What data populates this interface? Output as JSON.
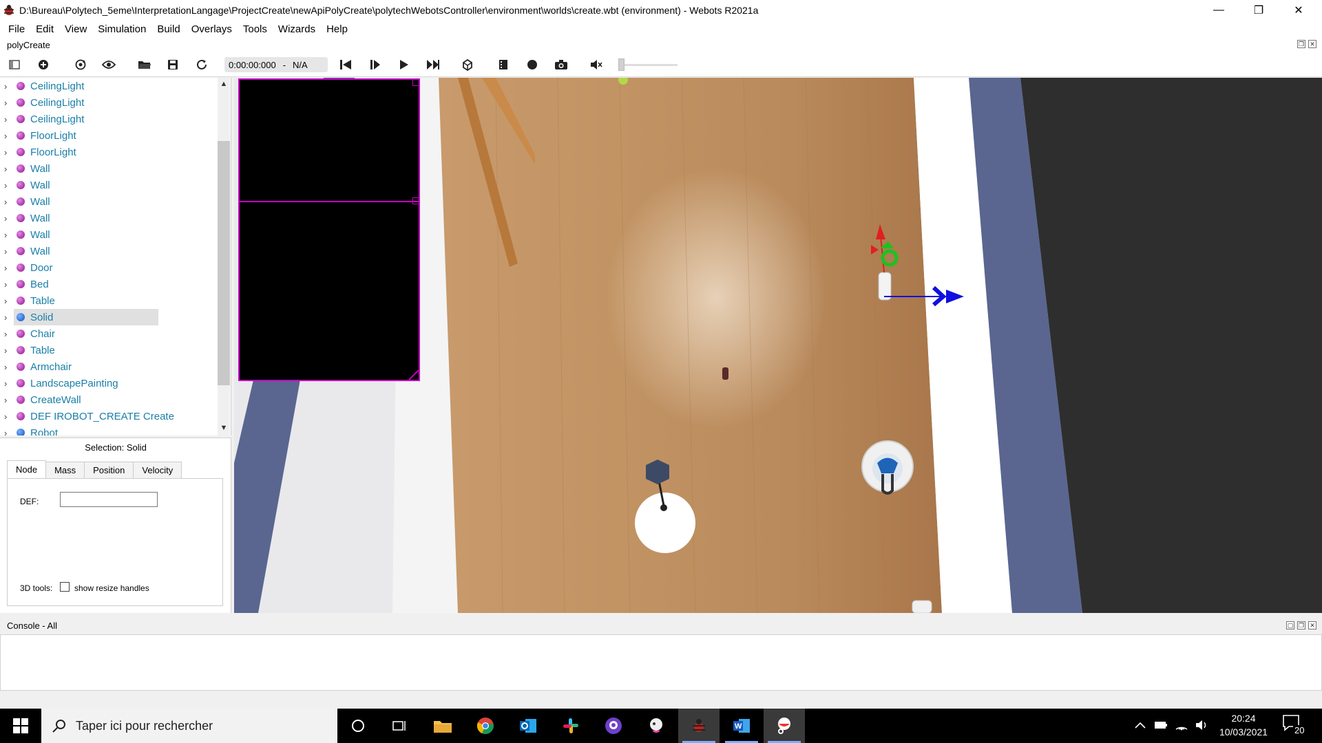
{
  "window": {
    "title": "D:\\Bureau\\Polytech_5eme\\InterpretationLangage\\ProjectCreate\\newApiPolyCreate\\polytechWebotsController\\environment\\worlds\\create.wbt (environment) - Webots R2021a",
    "minimize": "—",
    "restore": "❐",
    "close": "✕"
  },
  "menu": [
    "File",
    "Edit",
    "View",
    "Simulation",
    "Build",
    "Overlays",
    "Tools",
    "Wizards",
    "Help"
  ],
  "world": {
    "name": "polyCreate"
  },
  "toolbar": {
    "time": "0:00:00:000",
    "separator": "-",
    "speed": "N/A"
  },
  "scene_tree": {
    "items": [
      {
        "label": "CeilingLight",
        "kind": "proto"
      },
      {
        "label": "CeilingLight",
        "kind": "proto"
      },
      {
        "label": "CeilingLight",
        "kind": "proto"
      },
      {
        "label": "FloorLight",
        "kind": "proto"
      },
      {
        "label": "FloorLight",
        "kind": "proto"
      },
      {
        "label": "Wall",
        "kind": "proto"
      },
      {
        "label": "Wall",
        "kind": "proto"
      },
      {
        "label": "Wall",
        "kind": "proto"
      },
      {
        "label": "Wall",
        "kind": "proto"
      },
      {
        "label": "Wall",
        "kind": "proto"
      },
      {
        "label": "Wall",
        "kind": "proto"
      },
      {
        "label": "Door",
        "kind": "proto"
      },
      {
        "label": "Bed",
        "kind": "proto"
      },
      {
        "label": "Table",
        "kind": "proto"
      },
      {
        "label": "Solid",
        "kind": "solid",
        "selected": true
      },
      {
        "label": "Chair",
        "kind": "proto"
      },
      {
        "label": "Table",
        "kind": "proto"
      },
      {
        "label": "Armchair",
        "kind": "proto"
      },
      {
        "label": "LandscapePainting",
        "kind": "proto"
      },
      {
        "label": "CreateWall",
        "kind": "proto"
      },
      {
        "label": "DEF IROBOT_CREATE Create",
        "kind": "proto"
      },
      {
        "label": "Robot",
        "kind": "solid"
      }
    ]
  },
  "properties": {
    "selection": "Selection: Solid",
    "tabs": [
      "Node",
      "Mass",
      "Position",
      "Velocity"
    ],
    "active_tab": "Node",
    "def_label": "DEF:",
    "def_value": "",
    "tools_label": "3D tools:",
    "resize_handles_label": "show resize handles"
  },
  "console": {
    "title": "Console - All"
  },
  "taskbar": {
    "search_placeholder": "Taper ici pour rechercher",
    "time": "20:24",
    "date": "10/03/2021",
    "notifications": "20"
  },
  "colors": {
    "proto_node": "#a020a0",
    "solid_node": "#1560d0",
    "tree_text": "#1a7fa8",
    "overlay_border": "#c800c8",
    "floor": "#b8875a",
    "wall_blue": "#5a6690"
  }
}
